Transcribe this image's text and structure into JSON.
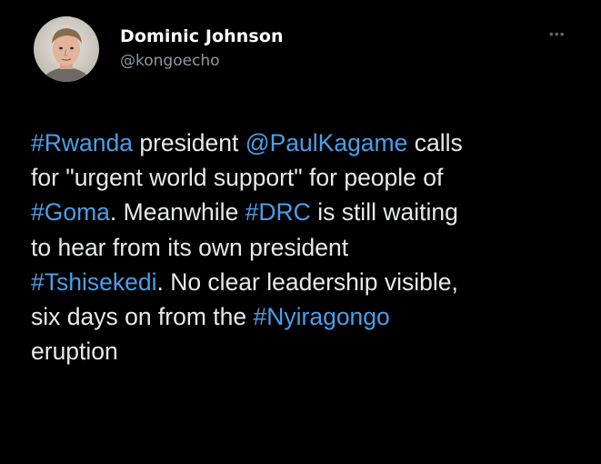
{
  "author": {
    "display_name": "Dominic Johnson",
    "handle": "@kongoecho"
  },
  "menu_icon": "more-dots-icon",
  "tweet": {
    "lines": [
      [
        {
          "text": "#Rwanda",
          "link": true
        },
        {
          "text": " president ",
          "link": false
        },
        {
          "text": "@PaulKagame",
          "link": true
        },
        {
          "text": " calls",
          "link": false
        }
      ],
      [
        {
          "text": "for \"urgent world support\" for people of",
          "link": false
        }
      ],
      [
        {
          "text": "#Goma",
          "link": true
        },
        {
          "text": ". Meanwhile ",
          "link": false
        },
        {
          "text": "#DRC",
          "link": true
        },
        {
          "text": " is still waiting",
          "link": false
        }
      ],
      [
        {
          "text": "to hear from its own president",
          "link": false
        }
      ],
      [
        {
          "text": "#Tshisekedi",
          "link": true
        },
        {
          "text": ". No clear leadership visible,",
          "link": false
        }
      ],
      [
        {
          "text": "six days on from the ",
          "link": false
        },
        {
          "text": "#Nyiragongo",
          "link": true
        }
      ],
      [
        {
          "text": "eruption",
          "link": false
        }
      ]
    ]
  },
  "colors": {
    "background": "#000000",
    "text": "#e7e9ea",
    "link": "#4a9fe8",
    "handle": "#8b98a5"
  }
}
